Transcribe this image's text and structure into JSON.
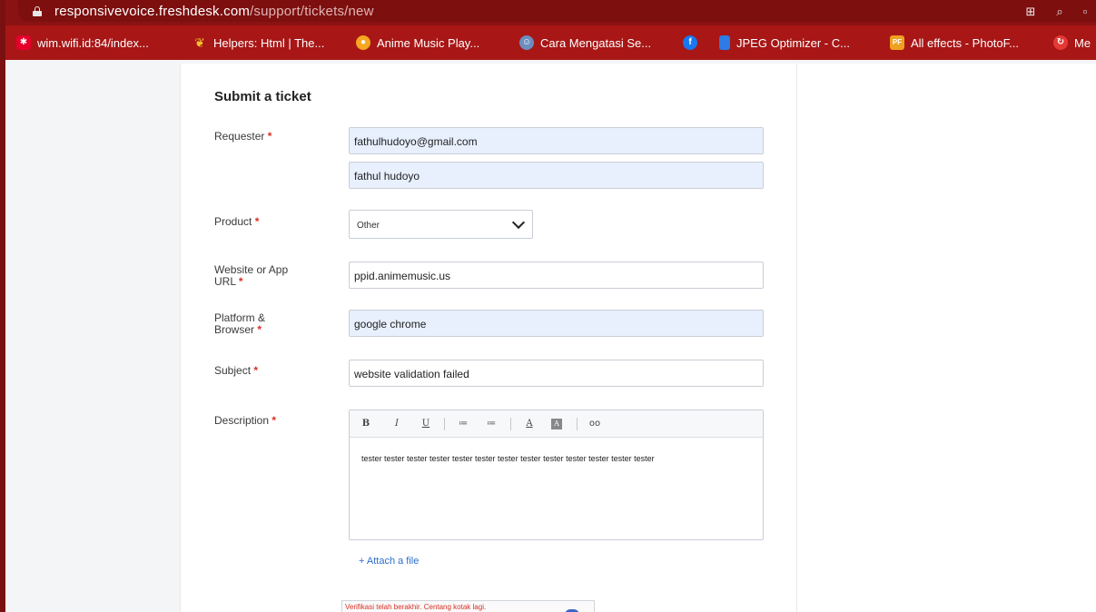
{
  "browser": {
    "url_host": "responsivevoice.freshdesk.com",
    "url_path": "/support/tickets/new"
  },
  "bookmarks": [
    {
      "label": "wim.wifi.id:84/index...",
      "icon": "wifi-id-icon",
      "color": "#e4002b"
    },
    {
      "label": "Helpers: Html | The...",
      "icon": "helpers-leaf-icon",
      "color": "#7ab648"
    },
    {
      "label": "Anime Music Play...",
      "icon": "anime-music-icon",
      "color": "#f5a623"
    },
    {
      "label": "Cara Mengatasi Se...",
      "icon": "cara-avatar-icon",
      "color": "#6c8ebf"
    },
    {
      "label": "",
      "icon": "facebook-icon",
      "color": "#1877f2"
    },
    {
      "label": "JPEG Optimizer - C...",
      "icon": "jpeg-doc-icon",
      "color": "#2d7be5"
    },
    {
      "label": "All effects - PhotoF...",
      "icon": "photofunia-icon",
      "color": "#f0a020"
    },
    {
      "label": "Me",
      "icon": "me-icon",
      "color": "#e53935"
    }
  ],
  "form": {
    "title": "Submit a ticket",
    "required_mark": "*",
    "requester_label": "Requester",
    "requester_email": "fathulhudoyo@gmail.com",
    "requester_name": "fathul hudoyo",
    "product_label": "Product",
    "product_value": "Other",
    "website_label_1": "Website or App",
    "website_label_2": "URL",
    "website_value": "ppid.animemusic.us",
    "platform_label_1": "Platform &",
    "platform_label_2": "Browser",
    "platform_value": "google chrome",
    "subject_label": "Subject",
    "subject_value": "website validation failed",
    "description_label": "Description",
    "description_value": "tester tester tester tester tester tester tester tester tester tester tester tester tester",
    "attach_label": "+ Attach a file",
    "captcha_error": "Verifikasi telah berakhir. Centang kotak lagi."
  },
  "toolbar": {
    "bold": "B",
    "italic": "I",
    "underline": "U",
    "bullet_list": "≔",
    "numbered_list": "≔",
    "font_color": "A",
    "bg_color": "A",
    "link": "oo"
  },
  "colors": {
    "browser_bar": "#8a1212",
    "bookmark_bar": "#a81616",
    "required": "#d93025",
    "link": "#2c6ecb",
    "autofill": "#e8f0fe"
  }
}
